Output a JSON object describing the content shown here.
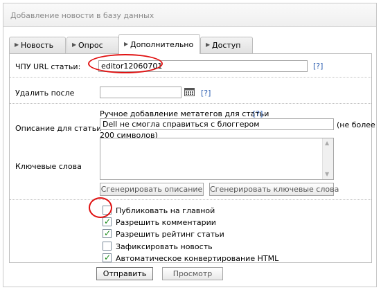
{
  "panel": {
    "title": "Добавление новости в базу данных"
  },
  "tabs": [
    {
      "label": "Новость",
      "active": false
    },
    {
      "label": "Опрос",
      "active": false
    },
    {
      "label": "Дополнительно",
      "active": true
    },
    {
      "label": "Доступ",
      "active": false
    }
  ],
  "url": {
    "label": "ЧПУ URL статьи:",
    "value": "editor12060701",
    "help": "[?]"
  },
  "delete_after": {
    "label": "Удалить после",
    "value": "",
    "help": "[?]"
  },
  "meta": {
    "heading": "Ручное добавление метатегов для статьи",
    "help": "[?]",
    "description_label": "Описание для статьи",
    "description_value": "Dell не смогла справиться с блоггером",
    "limit_note_line1": "(не более",
    "limit_note_line2": "200 символов)",
    "keywords_label": "Ключевые слова",
    "keywords_value": "",
    "generate_description": "Сгенерировать описание",
    "generate_keywords": "Сгенерировать ключевые слова"
  },
  "options": [
    {
      "label": "Публиковать на главной",
      "checked": false
    },
    {
      "label": "Разрешить комментарии",
      "checked": true
    },
    {
      "label": "Разрешить рейтинг статьи",
      "checked": true
    },
    {
      "label": "Зафиксировать новость",
      "checked": false
    },
    {
      "label": "Автоматическое конвертирование HTML",
      "checked": true
    }
  ],
  "actions": {
    "submit": "Отправить",
    "preview": "Просмотр"
  },
  "colors": {
    "annotation": "#e01010",
    "link": "#2a5db0",
    "check": "#1a8a1a"
  }
}
